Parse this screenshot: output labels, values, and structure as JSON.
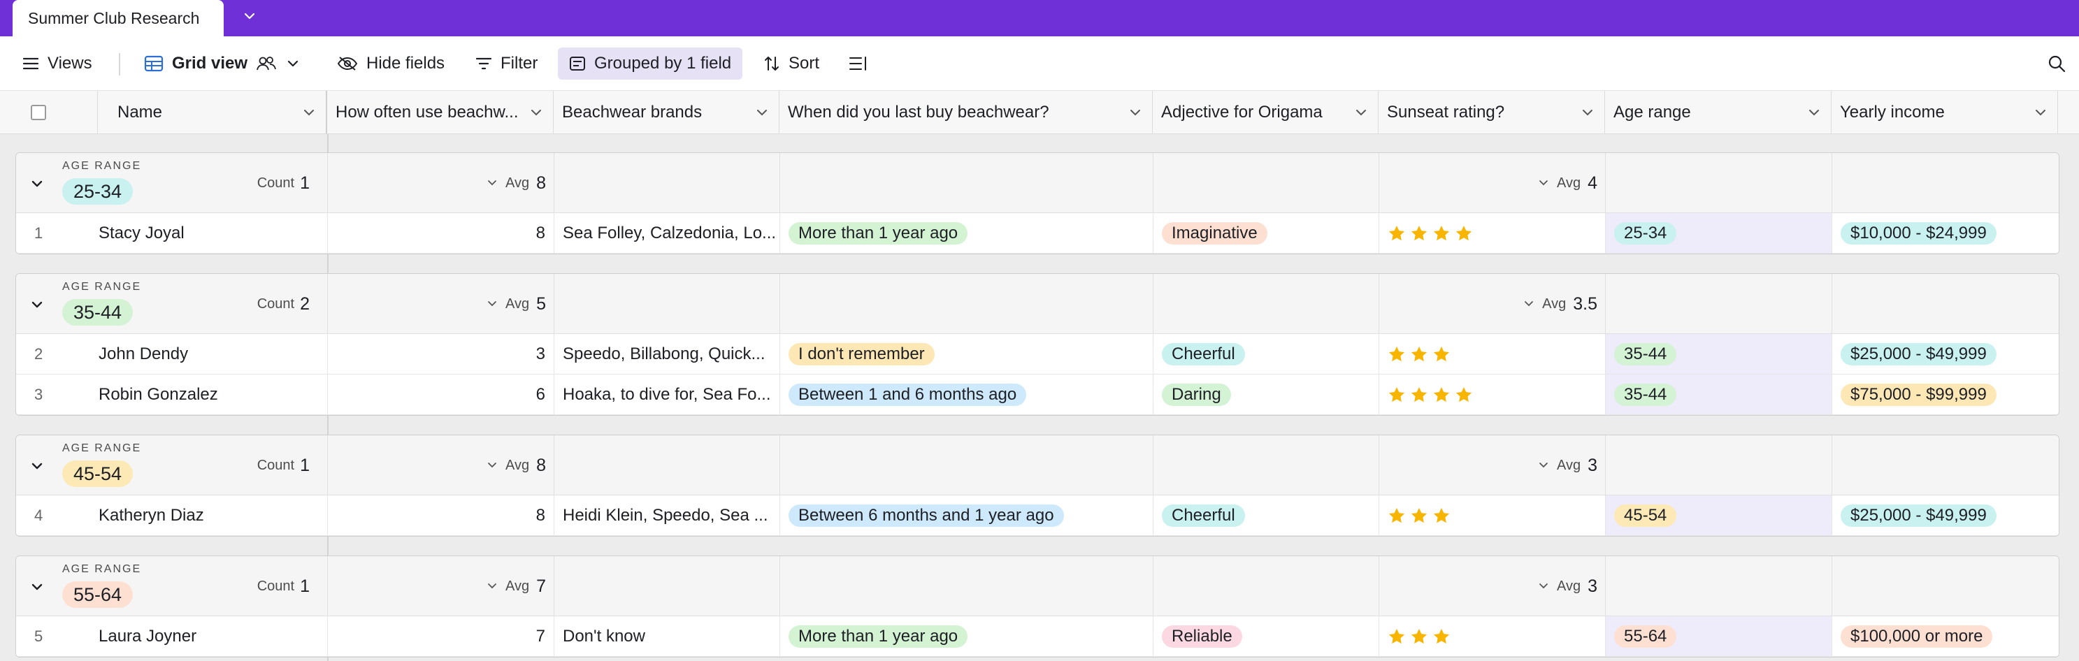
{
  "app": {
    "tab_title": "Summer Club Research"
  },
  "toolbar": {
    "views": "Views",
    "grid_view": "Grid view",
    "hide_fields": "Hide fields",
    "filter": "Filter",
    "grouped": "Grouped by 1 field",
    "sort": "Sort"
  },
  "columns": {
    "name": "Name",
    "usage": "How often use beachw...",
    "brands": "Beachwear brands",
    "last_buy": "When did you last buy beachwear?",
    "adjective": "Adjective for Origama",
    "rating": "Sunseat rating?",
    "age": "Age range",
    "income": "Yearly income"
  },
  "colors": {
    "accent": "#6f31d7",
    "star": "#f7b500",
    "age_25_34": "#c8f1ef",
    "age_35_44": "#d4f2d4",
    "age_45_54": "#fde9b5",
    "age_55_64": "#fde0d2",
    "when_more": "#d3f3d3",
    "when_remember": "#fde7b5",
    "when_between": "#cde9fb",
    "adj_imaginative": "#fde0d2",
    "adj_cheerful": "#c8f1ef",
    "adj_daring": "#d4f2d4",
    "adj_reliable": "#fcd9e2",
    "inc_teal": "#c8f1ef",
    "inc_yellow": "#fde7b5",
    "inc_peach": "#fde0d2"
  },
  "groups": [
    {
      "label": "AGE RANGE",
      "value": "25-34",
      "count_label": "Count",
      "count": "1",
      "avg_label": "Avg",
      "usage_avg": "8",
      "rating_avg": "4",
      "rows": [
        {
          "n": "1",
          "name": "Stacy Joyal",
          "usage": "8",
          "brands": "Sea Folley, Calzedonia, Lo...",
          "last_buy": "More than 1 year ago",
          "adjective": "Imaginative",
          "stars": 4,
          "age": "25-34",
          "income": "$10,000 - $24,999"
        }
      ]
    },
    {
      "label": "AGE RANGE",
      "value": "35-44",
      "count_label": "Count",
      "count": "2",
      "avg_label": "Avg",
      "usage_avg": "5",
      "rating_avg": "3.5",
      "rows": [
        {
          "n": "2",
          "name": "John Dendy",
          "usage": "3",
          "brands": "Speedo, Billabong, Quick...",
          "last_buy": "I don't remember",
          "adjective": "Cheerful",
          "stars": 3,
          "age": "35-44",
          "income": "$25,000 - $49,999"
        },
        {
          "n": "3",
          "name": "Robin Gonzalez",
          "usage": "6",
          "brands": "Hoaka, to dive for, Sea Fo...",
          "last_buy": "Between 1 and 6 months ago",
          "adjective": "Daring",
          "stars": 4,
          "age": "35-44",
          "income": "$75,000 - $99,999"
        }
      ]
    },
    {
      "label": "AGE RANGE",
      "value": "45-54",
      "count_label": "Count",
      "count": "1",
      "avg_label": "Avg",
      "usage_avg": "8",
      "rating_avg": "3",
      "rows": [
        {
          "n": "4",
          "name": "Katheryn Diaz",
          "usage": "8",
          "brands": "Heidi Klein, Speedo, Sea ...",
          "last_buy": "Between 6 months and 1 year ago",
          "adjective": "Cheerful",
          "stars": 3,
          "age": "45-54",
          "income": "$25,000 - $49,999"
        }
      ]
    },
    {
      "label": "AGE RANGE",
      "value": "55-64",
      "count_label": "Count",
      "count": "1",
      "avg_label": "Avg",
      "usage_avg": "7",
      "rating_avg": "3",
      "rows": [
        {
          "n": "5",
          "name": "Laura Joyner",
          "usage": "7",
          "brands": "Don't know",
          "last_buy": "More than 1 year ago",
          "adjective": "Reliable",
          "stars": 3,
          "age": "55-64",
          "income": "$100,000 or more"
        }
      ]
    }
  ]
}
